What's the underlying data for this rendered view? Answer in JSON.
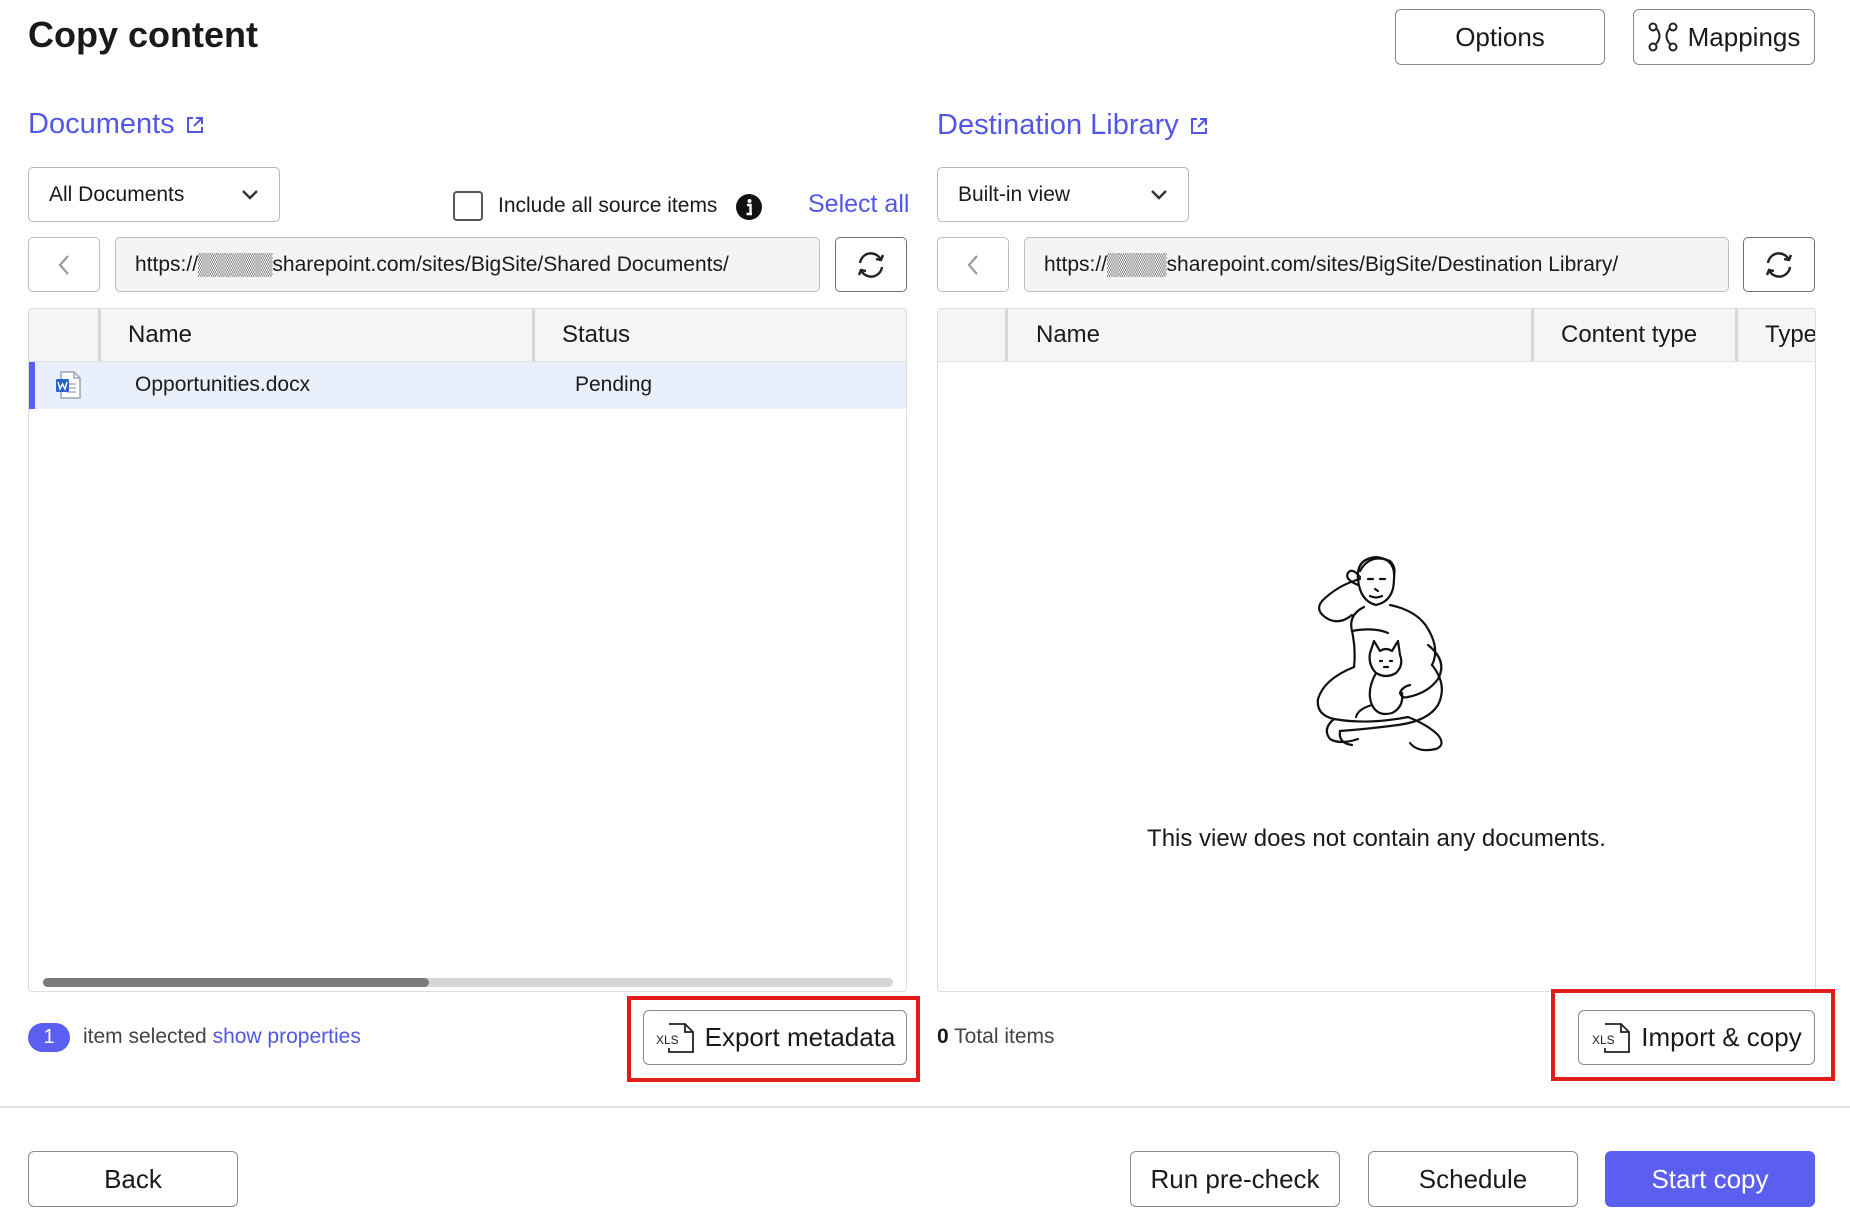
{
  "header": {
    "title": "Copy content",
    "options_label": "Options",
    "mappings_label": "Mappings"
  },
  "source": {
    "library_title": "Documents",
    "view": "All Documents",
    "include_all_label": "Include all source items",
    "select_all_label": "Select all",
    "url": "https://▒▒▒▒▒sharepoint.com/sites/BigSite/Shared Documents/",
    "columns": [
      "Name",
      "Status"
    ],
    "rows": [
      {
        "name": "Opportunities.docx",
        "status": "Pending",
        "icon": "word-doc-icon"
      }
    ],
    "selected_count": "1",
    "selected_text": "item selected",
    "show_properties_label": "show properties",
    "export_label": "Export metadata",
    "xls_glyph": "XLS"
  },
  "destination": {
    "library_title": "Destination Library",
    "view": "Built-in view",
    "url": "https://▒▒▒▒sharepoint.com/sites/BigSite/Destination Library/",
    "columns": [
      "Name",
      "Content type",
      "Type"
    ],
    "empty_message": "This view does not contain any documents.",
    "total_count": "0",
    "total_label": "Total items",
    "import_label": "Import & copy",
    "xls_glyph": "XLS"
  },
  "footer": {
    "back_label": "Back",
    "precheck_label": "Run pre-check",
    "schedule_label": "Schedule",
    "start_label": "Start copy"
  },
  "colors": {
    "accent": "#5b5ff0",
    "link": "#5257e6",
    "highlight": "#e21b1b",
    "selected_row": "#eaf0fb"
  }
}
